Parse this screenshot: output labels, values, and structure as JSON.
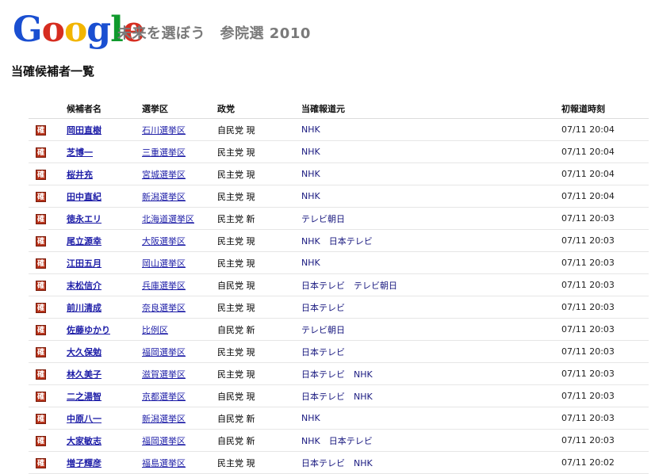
{
  "header": {
    "logo_letters": [
      "G",
      "o",
      "o",
      "g",
      "l",
      "e"
    ],
    "site_title": "未来を選ぼう　参院選 2010"
  },
  "page": {
    "title": "当確候補者一覧"
  },
  "table": {
    "columns": [
      "候補者名",
      "選挙区",
      "政党",
      "当確報道元",
      "初報道時刻"
    ],
    "badge_label": "確",
    "rows": [
      {
        "name": "岡田直樹",
        "district": "石川選挙区",
        "party": "自民党 現",
        "media": "NHK",
        "time": "07/11 20:04"
      },
      {
        "name": "芝博一",
        "district": "三重選挙区",
        "party": "民主党 現",
        "media": "NHK",
        "time": "07/11 20:04"
      },
      {
        "name": "桜井充",
        "district": "宮城選挙区",
        "party": "民主党 現",
        "media": "NHK",
        "time": "07/11 20:04"
      },
      {
        "name": "田中直紀",
        "district": "新潟選挙区",
        "party": "民主党 現",
        "media": "NHK",
        "time": "07/11 20:04"
      },
      {
        "name": "徳永エリ",
        "district": "北海道選挙区",
        "party": "民主党 新",
        "media": "テレビ朝日",
        "time": "07/11 20:03"
      },
      {
        "name": "尾立源幸",
        "district": "大阪選挙区",
        "party": "民主党 現",
        "media": "NHK　日本テレビ",
        "time": "07/11 20:03"
      },
      {
        "name": "江田五月",
        "district": "岡山選挙区",
        "party": "民主党 現",
        "media": "NHK",
        "time": "07/11 20:03"
      },
      {
        "name": "末松信介",
        "district": "兵庫選挙区",
        "party": "自民党 現",
        "media": "日本テレビ　テレビ朝日",
        "time": "07/11 20:03"
      },
      {
        "name": "前川清成",
        "district": "奈良選挙区",
        "party": "民主党 現",
        "media": "日本テレビ",
        "time": "07/11 20:03"
      },
      {
        "name": "佐藤ゆかり",
        "district": "比例区",
        "party": "自民党 新",
        "media": "テレビ朝日",
        "time": "07/11 20:03"
      },
      {
        "name": "大久保勉",
        "district": "福岡選挙区",
        "party": "民主党 現",
        "media": "日本テレビ",
        "time": "07/11 20:03"
      },
      {
        "name": "林久美子",
        "district": "滋賀選挙区",
        "party": "民主党 現",
        "media": "日本テレビ　NHK",
        "time": "07/11 20:03"
      },
      {
        "name": "二之湯智",
        "district": "京都選挙区",
        "party": "自民党 現",
        "media": "日本テレビ　NHK",
        "time": "07/11 20:03"
      },
      {
        "name": "中原八一",
        "district": "新潟選挙区",
        "party": "自民党 新",
        "media": "NHK",
        "time": "07/11 20:03"
      },
      {
        "name": "大家敏志",
        "district": "福岡選挙区",
        "party": "自民党 新",
        "media": "NHK　日本テレビ",
        "time": "07/11 20:03"
      },
      {
        "name": "増子輝彦",
        "district": "福島選挙区",
        "party": "民主党 現",
        "media": "日本テレビ　NHK",
        "time": "07/11 20:02"
      }
    ]
  }
}
